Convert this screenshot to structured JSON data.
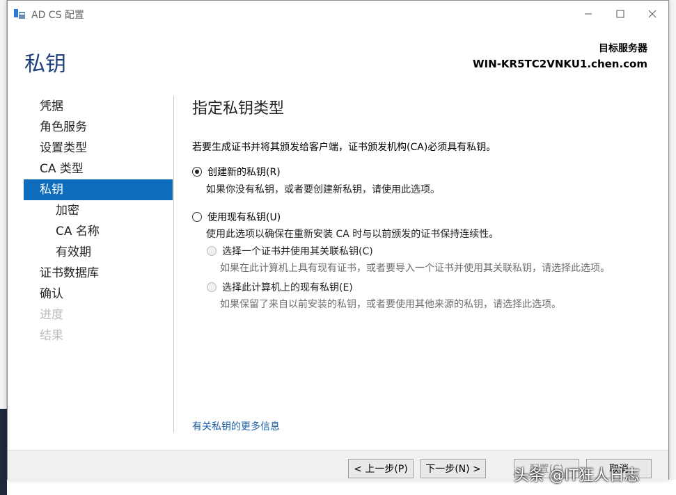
{
  "window": {
    "title": "AD CS 配置",
    "header_title": "私钥",
    "target_label": "目标服务器",
    "target_server": "WIN-KR5TC2VNKU1.chen.com"
  },
  "nav": {
    "items": [
      {
        "label": "凭据",
        "state": "normal",
        "level": 0
      },
      {
        "label": "角色服务",
        "state": "normal",
        "level": 0
      },
      {
        "label": "设置类型",
        "state": "normal",
        "level": 0
      },
      {
        "label": "CA 类型",
        "state": "normal",
        "level": 0
      },
      {
        "label": "私钥",
        "state": "active",
        "level": 0
      },
      {
        "label": "加密",
        "state": "normal",
        "level": 1
      },
      {
        "label": "CA 名称",
        "state": "normal",
        "level": 1
      },
      {
        "label": "有效期",
        "state": "normal",
        "level": 1
      },
      {
        "label": "证书数据库",
        "state": "normal",
        "level": 0
      },
      {
        "label": "确认",
        "state": "normal",
        "level": 0
      },
      {
        "label": "进度",
        "state": "disabled",
        "level": 0
      },
      {
        "label": "结果",
        "state": "disabled",
        "level": 0
      }
    ]
  },
  "main": {
    "section_title": "指定私钥类型",
    "intro": "若要生成证书并将其颁发给客户端，证书颁发机构(CA)必须具有私钥。",
    "options": {
      "create_new": {
        "label": "创建新的私钥(R)",
        "desc": "如果你没有私钥，或者要创建新私钥，请使用此选项。",
        "selected": true
      },
      "use_existing": {
        "label": "使用现有私钥(U)",
        "desc": "使用此选项以确保在重新安装 CA 时与以前颁发的证书保持连续性。",
        "selected": false
      },
      "select_cert": {
        "label": "选择一个证书并使用其关联私钥(C)",
        "desc": "如果在此计算机上具有现有证书，或者要导入一个证书并使用其关联私钥，请选择此选项。",
        "selected": false
      },
      "select_existing_key": {
        "label": "选择此计算机上的现有私钥(E)",
        "desc": "如果保留了来自以前安装的私钥，或者要使用其他来源的私钥，请选择此选项。",
        "selected": false
      }
    },
    "more_info_link": "有关私钥的更多信息"
  },
  "footer": {
    "prev": "< 上一步(P)",
    "next": "下一步(N) >",
    "install": "配置(C)",
    "cancel": "取消"
  },
  "watermark": "头条 @IT狂人日志",
  "colors": {
    "accent": "#0f6cbd",
    "header_title": "#1f3f7a",
    "link": "#1a5fa8"
  }
}
